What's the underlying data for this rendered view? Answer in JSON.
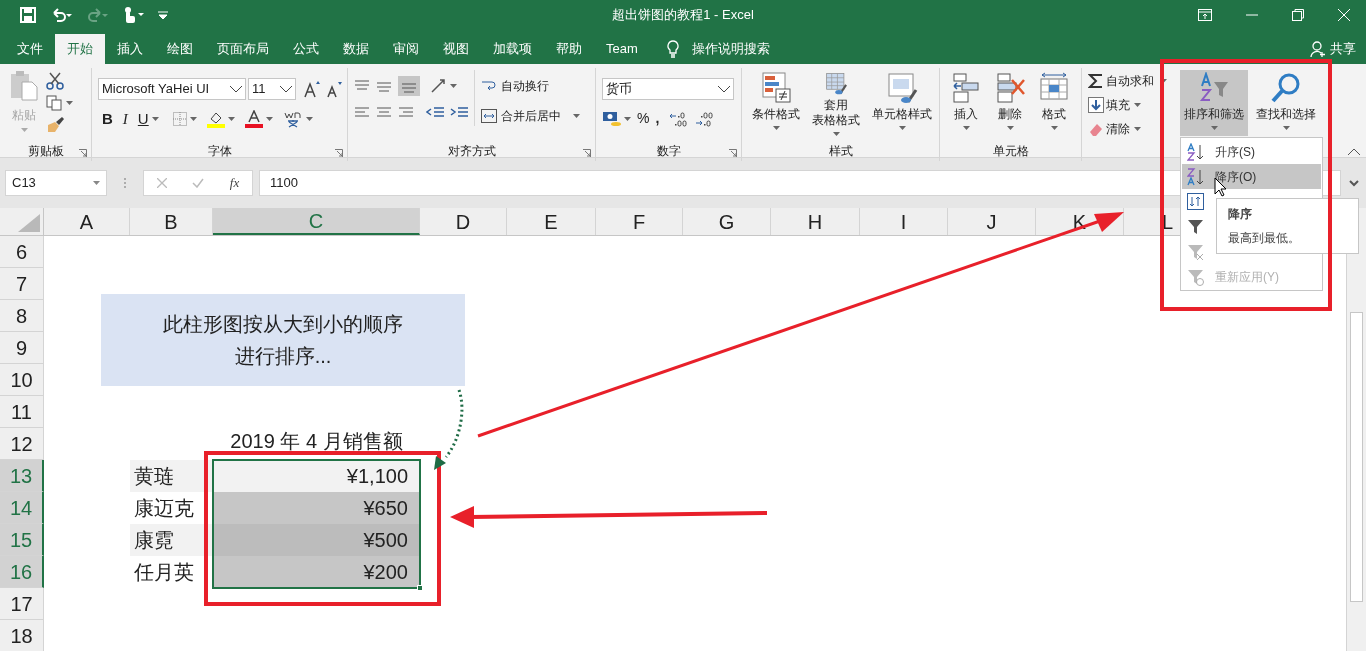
{
  "window": {
    "title": "超出饼图的教程1  -  Excel"
  },
  "menu_tabs": [
    {
      "label": "文件",
      "selected": false
    },
    {
      "label": "开始",
      "selected": true
    },
    {
      "label": "插入",
      "selected": false
    },
    {
      "label": "绘图",
      "selected": false
    },
    {
      "label": "页面布局",
      "selected": false
    },
    {
      "label": "公式",
      "selected": false
    },
    {
      "label": "数据",
      "selected": false
    },
    {
      "label": "审阅",
      "selected": false
    },
    {
      "label": "视图",
      "selected": false
    },
    {
      "label": "加载项",
      "selected": false
    },
    {
      "label": "帮助",
      "selected": false
    },
    {
      "label": "Team",
      "selected": false
    }
  ],
  "tell_me": "操作说明搜索",
  "share": "共享",
  "ribbon": {
    "clipboard": {
      "label": "剪贴板",
      "paste": {
        "label": "粘贴",
        "disabled": true
      }
    },
    "font": {
      "label": "字体",
      "font_name": "Microsoft YaHei UI",
      "font_size": "11",
      "bold": "B",
      "italic": "I",
      "underline": "U"
    },
    "alignment": {
      "label": "对齐方式",
      "wrap_text": "自动换行",
      "merge_center": "合并后居中"
    },
    "number": {
      "label": "数字",
      "format": "货币",
      "percent": "%",
      "comma": ","
    },
    "styles": {
      "label": "样式",
      "buttons": [
        [
          "条件格式"
        ],
        [
          "套用",
          "表格格式"
        ],
        [
          "单元格样式"
        ]
      ]
    },
    "cells": {
      "label": "单元格",
      "buttons": [
        "插入",
        "删除",
        "格式"
      ]
    },
    "editing": {
      "autosum": "自动求和",
      "fill": "填充",
      "clear": "清除",
      "sort_filter": {
        "label": "排序和筛选",
        "expanded": true
      },
      "find_select": "查找和选择"
    }
  },
  "formula_bar": {
    "name_box": "C13",
    "fx": "fx",
    "value": "1100"
  },
  "columns": [
    {
      "label": "A",
      "selected": false
    },
    {
      "label": "B",
      "selected": false
    },
    {
      "label": "C",
      "selected": true
    },
    {
      "label": "D",
      "selected": false
    },
    {
      "label": "E",
      "selected": false
    },
    {
      "label": "F",
      "selected": false
    },
    {
      "label": "G",
      "selected": false
    },
    {
      "label": "H",
      "selected": false
    },
    {
      "label": "I",
      "selected": false
    },
    {
      "label": "J",
      "selected": false
    },
    {
      "label": "K",
      "selected": false
    },
    {
      "label": "L",
      "selected": false
    }
  ],
  "rows": [
    {
      "label": "6",
      "selected": false
    },
    {
      "label": "7",
      "selected": false
    },
    {
      "label": "8",
      "selected": false
    },
    {
      "label": "9",
      "selected": false
    },
    {
      "label": "10",
      "selected": false
    },
    {
      "label": "11",
      "selected": false
    },
    {
      "label": "12",
      "selected": false
    },
    {
      "label": "13",
      "selected": true
    },
    {
      "label": "14",
      "selected": true
    },
    {
      "label": "15",
      "selected": true
    },
    {
      "label": "16",
      "selected": true
    },
    {
      "label": "17",
      "selected": false
    },
    {
      "label": "18",
      "selected": false
    }
  ],
  "callout": {
    "lines": [
      "此柱形图按从大到小的顺序",
      "进行排序..."
    ]
  },
  "table": {
    "title": "2019 年 4 月销售额",
    "rows": [
      {
        "name": "黄琏",
        "value": "¥1,100",
        "banded": true,
        "active": true
      },
      {
        "name": "康迈克",
        "value": "¥650",
        "banded": false,
        "active": false
      },
      {
        "name": "康霓",
        "value": "¥500",
        "banded": true,
        "active": false
      },
      {
        "name": "任月英",
        "value": "¥200",
        "banded": false,
        "active": false
      }
    ]
  },
  "sort_menu": {
    "items": [
      {
        "kind": "ascending",
        "label": "升序(S)",
        "selected": false,
        "disabled": false
      },
      {
        "kind": "descending",
        "label": "降序(O)",
        "selected": true,
        "disabled": false
      },
      {
        "kind": "custom",
        "selected": false,
        "disabled": false
      },
      {
        "kind": "filter",
        "selected": false,
        "disabled": false
      },
      {
        "kind": "clear",
        "selected": false,
        "disabled": true
      },
      {
        "kind": "reapply",
        "label": "重新应用(Y)",
        "selected": false,
        "disabled": true
      }
    ]
  },
  "tooltip": {
    "title": "降序",
    "text": "最高到最低。"
  }
}
